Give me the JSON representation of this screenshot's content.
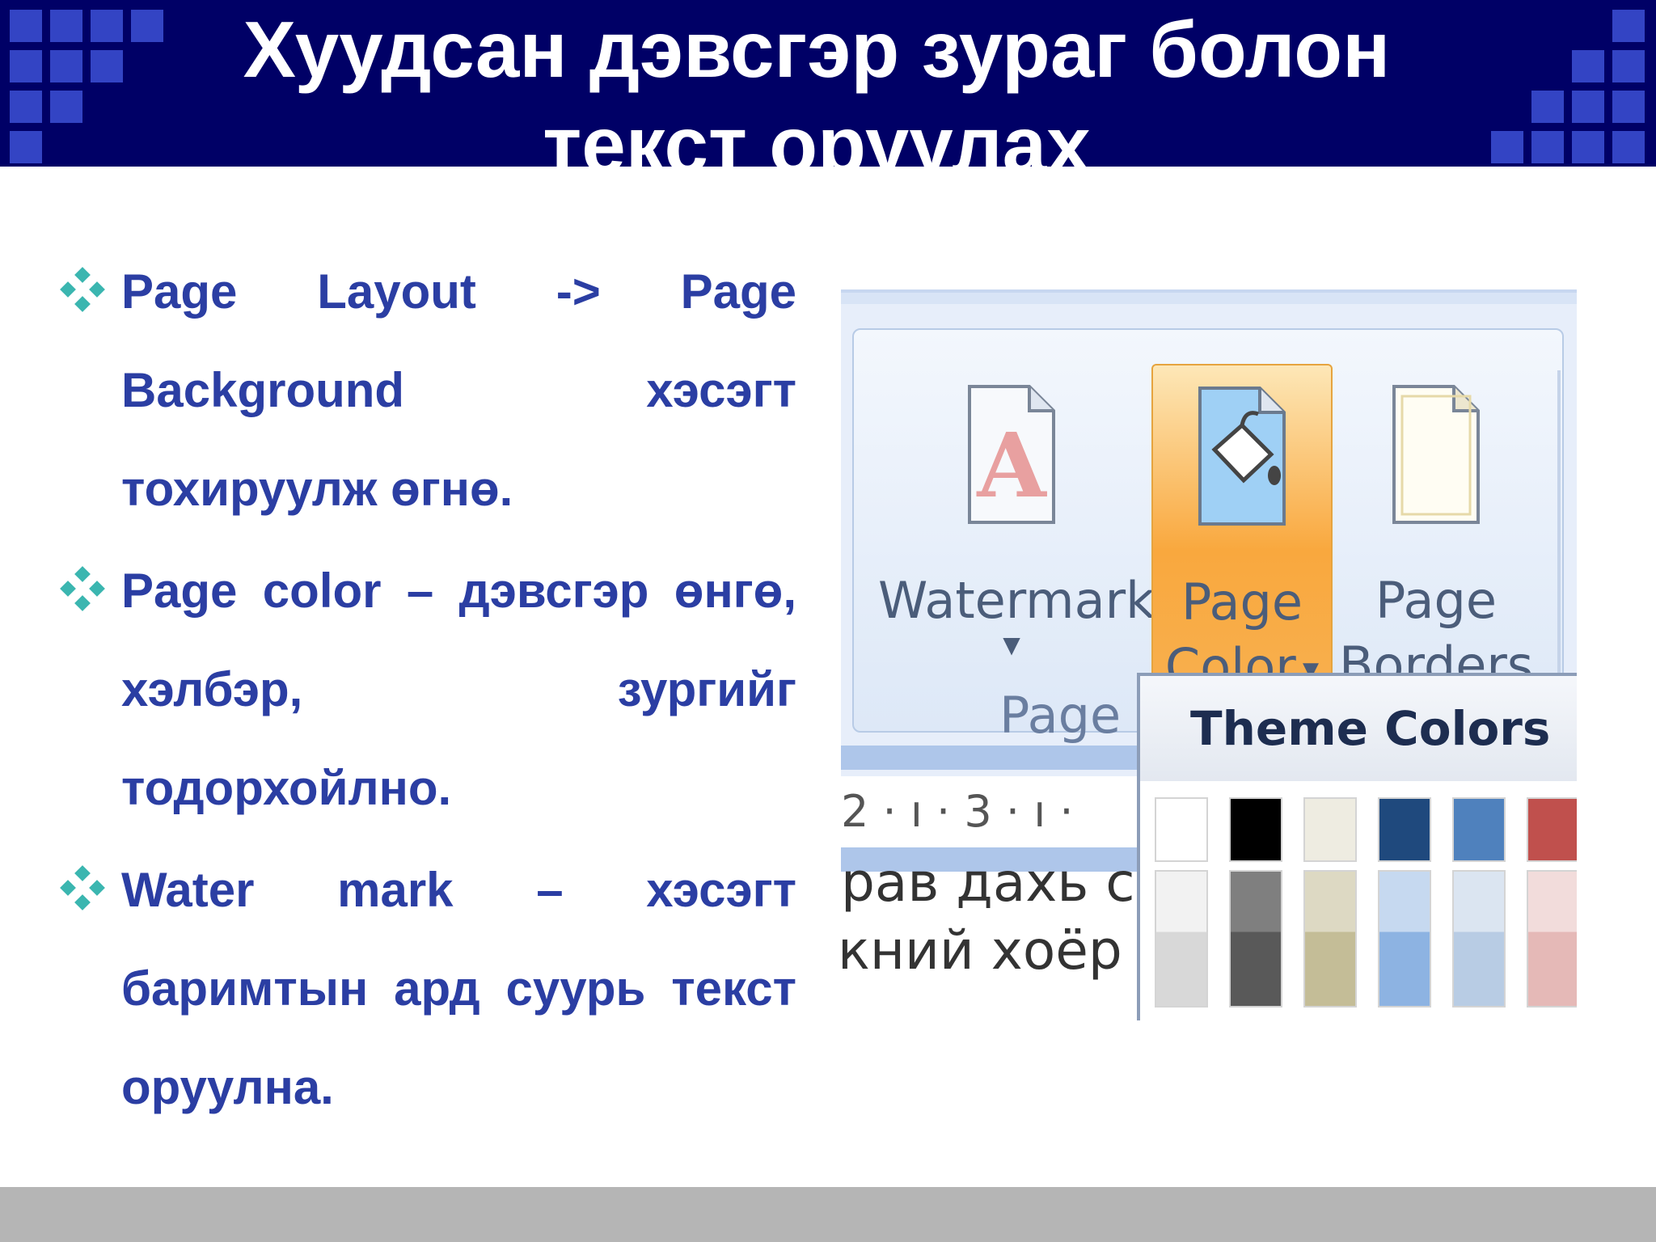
{
  "slide": {
    "title_line1": "Хуудсан дэвсгэр зураг болон",
    "title_line2": "текст оруулах"
  },
  "bullets": [
    {
      "text": "Page Layout -> Page Background хэсэгт тохируулж өгнө."
    },
    {
      "text": "Page color – дэвсгэр өнгө, хэлбэр, зургийг тодорхойлно."
    },
    {
      "text": "Water mark – хэсэгт баримтын ард суурь текст оруулна."
    }
  ],
  "screenshot": {
    "watermark_label": "Watermark",
    "page_color_label_1": "Page",
    "page_color_label_2": "Color",
    "page_borders_label_1": "Page",
    "page_borders_label_2": "Borders",
    "group_label": "Page B",
    "ruler_text": "2 · ı · 3 · ı ·",
    "doc_line1": "рав дахь с",
    "doc_line2": "кний хоёр е",
    "dropdown_title": "Theme Colors",
    "theme_colors_row1": [
      "#ffffff",
      "#000000",
      "#eeece1",
      "#1f497d",
      "#4f81bd",
      "#c0504d"
    ],
    "theme_colors_row2": [
      "#f2f2f2",
      "#7f7f7f",
      "#ddd9c3",
      "#c6d9f0",
      "#dbe5f1",
      "#f2dcdb"
    ],
    "theme_colors_row3": [
      "#d8d8d8",
      "#595959",
      "#c4bd97",
      "#8db3e2",
      "#b8cce4",
      "#e5b9b7"
    ]
  },
  "colors": {
    "header_bg": "#000066",
    "header_squares": "#3344c4",
    "bullet_text": "#2b3ea3",
    "bullet_icon": "#3bb6b0",
    "footer": "#b5b5b5"
  }
}
